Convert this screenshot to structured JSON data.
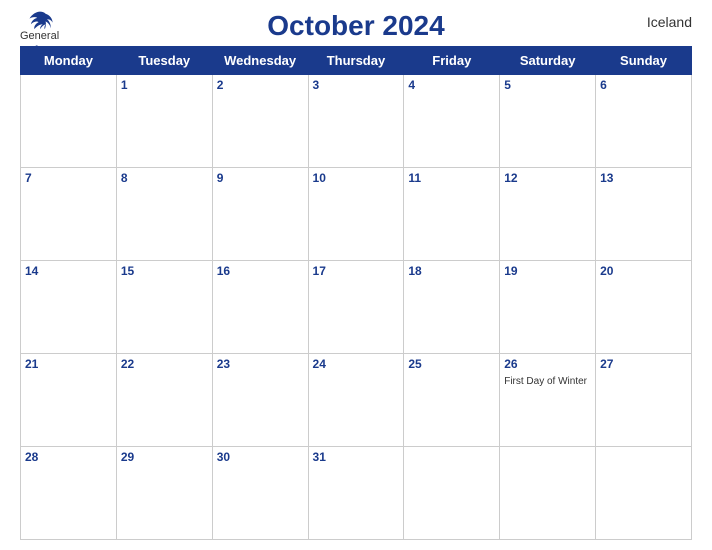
{
  "header": {
    "logo": {
      "general": "General",
      "blue": "Blue"
    },
    "title": "October 2024",
    "country": "Iceland"
  },
  "calendar": {
    "weekdays": [
      "Monday",
      "Tuesday",
      "Wednesday",
      "Thursday",
      "Friday",
      "Saturday",
      "Sunday"
    ],
    "weeks": [
      [
        {
          "day": "",
          "empty": true
        },
        {
          "day": "1",
          "empty": false
        },
        {
          "day": "2",
          "empty": false
        },
        {
          "day": "3",
          "empty": false
        },
        {
          "day": "4",
          "empty": false
        },
        {
          "day": "5",
          "empty": false
        },
        {
          "day": "6",
          "empty": false
        }
      ],
      [
        {
          "day": "7",
          "empty": false
        },
        {
          "day": "8",
          "empty": false
        },
        {
          "day": "9",
          "empty": false
        },
        {
          "day": "10",
          "empty": false
        },
        {
          "day": "11",
          "empty": false
        },
        {
          "day": "12",
          "empty": false
        },
        {
          "day": "13",
          "empty": false
        }
      ],
      [
        {
          "day": "14",
          "empty": false
        },
        {
          "day": "15",
          "empty": false
        },
        {
          "day": "16",
          "empty": false
        },
        {
          "day": "17",
          "empty": false
        },
        {
          "day": "18",
          "empty": false
        },
        {
          "day": "19",
          "empty": false
        },
        {
          "day": "20",
          "empty": false
        }
      ],
      [
        {
          "day": "21",
          "empty": false
        },
        {
          "day": "22",
          "empty": false
        },
        {
          "day": "23",
          "empty": false
        },
        {
          "day": "24",
          "empty": false
        },
        {
          "day": "25",
          "empty": false
        },
        {
          "day": "26",
          "empty": false,
          "event": "First Day of Winter"
        },
        {
          "day": "27",
          "empty": false
        }
      ],
      [
        {
          "day": "28",
          "empty": false
        },
        {
          "day": "29",
          "empty": false
        },
        {
          "day": "30",
          "empty": false
        },
        {
          "day": "31",
          "empty": false
        },
        {
          "day": "",
          "empty": true
        },
        {
          "day": "",
          "empty": true
        },
        {
          "day": "",
          "empty": true
        }
      ]
    ]
  }
}
